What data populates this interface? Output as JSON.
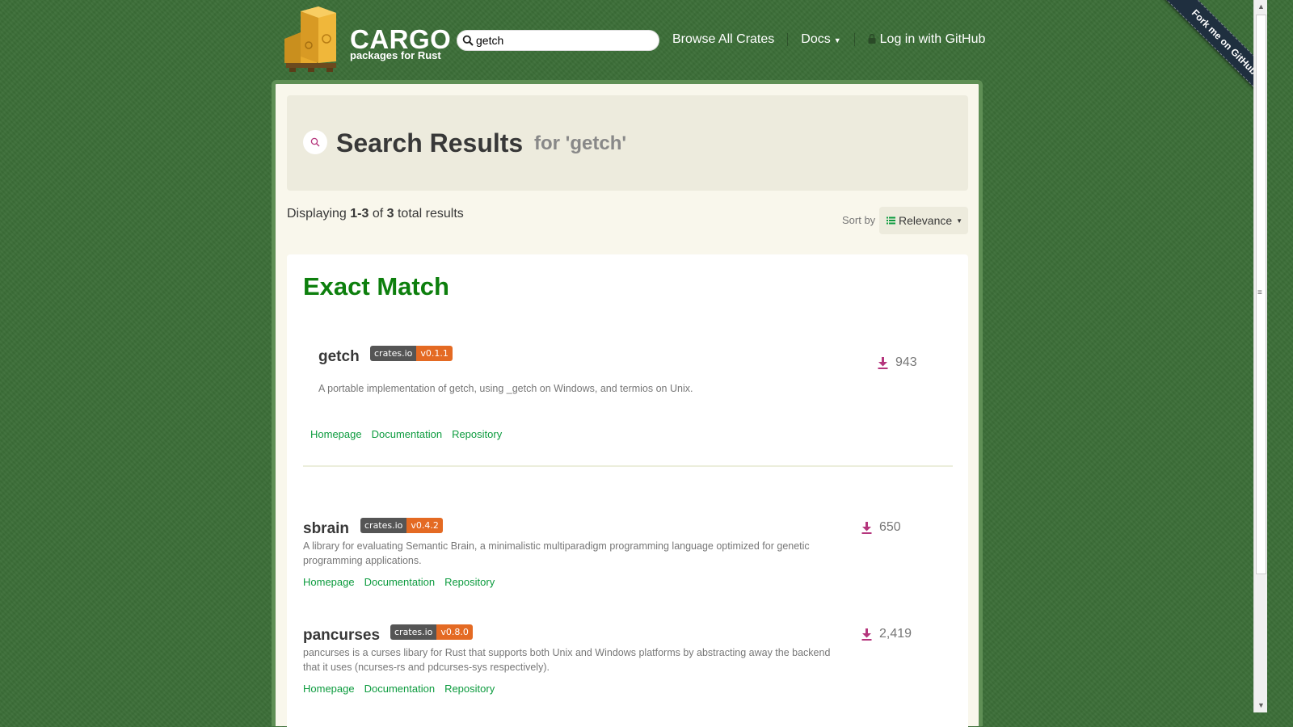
{
  "header": {
    "brand_title": "CARGO",
    "brand_subtitle": "packages for Rust",
    "search_value": "getch",
    "nav": {
      "browse": "Browse All Crates",
      "docs": "Docs",
      "login": "Log in with GitHub"
    }
  },
  "ribbon": {
    "text": "Fork me on GitHub"
  },
  "hero": {
    "title": "Search Results",
    "subtitle": "for 'getch'"
  },
  "summary": {
    "prefix": "Displaying ",
    "range": "1-3",
    "of": " of ",
    "total": "3",
    "suffix": " total results"
  },
  "sort": {
    "label": "Sort by",
    "value": "Relevance"
  },
  "exact_match": {
    "heading": "Exact Match",
    "crate": {
      "name": "getch",
      "badge_left": "crates.io",
      "badge_right": "v0.1.1",
      "description": "A portable implementation of getch, using _getch on Windows, and termios on Unix.",
      "downloads": "943",
      "links": {
        "homepage": "Homepage",
        "documentation": "Documentation",
        "repository": "Repository"
      }
    }
  },
  "results": [
    {
      "name": "sbrain",
      "badge_left": "crates.io",
      "badge_right": "v0.4.2",
      "description_line1": "A library for evaluating Semantic Brain, a minimalistic multiparadigm programming language optimized for genetic",
      "description_line2": "programming applications.",
      "downloads": "650",
      "links": {
        "homepage": "Homepage",
        "documentation": "Documentation",
        "repository": "Repository"
      }
    },
    {
      "name": "pancurses",
      "badge_left": "crates.io",
      "badge_right": "v0.8.0",
      "description_line1": "pancurses is a curses libary for Rust that supports both Unix and Windows platforms by abstracting away the backend",
      "description_line2": "that it uses (ncurses-rs and pdcurses-sys respectively).",
      "downloads": "2,419",
      "links": {
        "homepage": "Homepage",
        "documentation": "Documentation",
        "repository": "Repository"
      }
    }
  ],
  "colors": {
    "background": "#3b6e37",
    "accent_green": "#0d7f0d",
    "link_green": "#0c9b3e",
    "download_icon": "#b5367d",
    "badge_version": "#e46a23"
  }
}
